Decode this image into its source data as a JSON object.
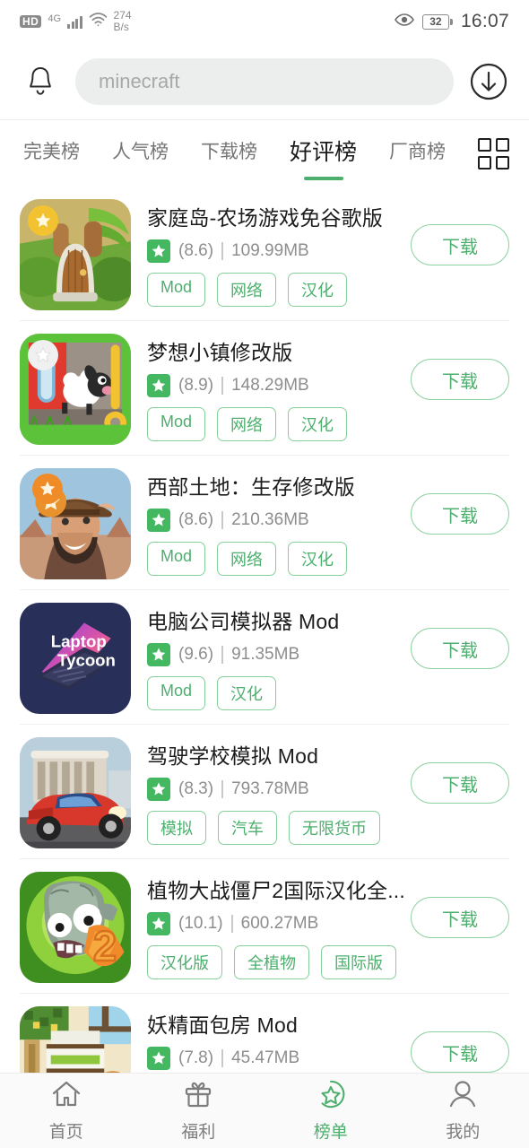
{
  "status_bar": {
    "hd_label": "HD",
    "network": "4G",
    "speed_value": "274",
    "speed_unit": "B/s",
    "eye_icon": "eye-icon",
    "battery_level": "32",
    "time": "16:07"
  },
  "header": {
    "bell_icon": "bell-icon",
    "download_icon": "download-circle-icon",
    "search_placeholder": "minecraft",
    "search_value": ""
  },
  "tabs": {
    "items": [
      {
        "label": "完美榜",
        "active": false
      },
      {
        "label": "人气榜",
        "active": false
      },
      {
        "label": "下载榜",
        "active": false
      },
      {
        "label": "好评榜",
        "active": true
      },
      {
        "label": "厂商榜",
        "active": false
      }
    ],
    "grid_icon": "grid-menu-icon"
  },
  "list": {
    "download_label": "下载",
    "items": [
      {
        "title": "家庭岛-农场游戏免谷歌版",
        "score": "(8.6)",
        "size": "109.99MB",
        "tags": [
          "Mod",
          "网络",
          "汉化"
        ],
        "icon": "family-island"
      },
      {
        "title": "梦想小镇修改版",
        "score": "(8.9)",
        "size": "148.29MB",
        "tags": [
          "Mod",
          "网络",
          "汉化"
        ],
        "icon": "township-sheep"
      },
      {
        "title": "西部土地：生存修改版",
        "score": "(8.6)",
        "size": "210.36MB",
        "tags": [
          "Mod",
          "网络",
          "汉化"
        ],
        "icon": "west-land-cowboy"
      },
      {
        "title": "电脑公司模拟器 Mod",
        "score": "(9.6)",
        "size": "91.35MB",
        "tags": [
          "Mod",
          "汉化"
        ],
        "icon": "laptop-tycoon",
        "icon_text_line1": "Laptop",
        "icon_text_line2": "Tycoon"
      },
      {
        "title": "驾驶学校模拟 Mod",
        "score": "(8.3)",
        "size": "793.78MB",
        "tags": [
          "模拟",
          "汽车",
          "无限货币"
        ],
        "icon": "driving-school-car"
      },
      {
        "title": "植物大战僵尸2国际汉化全...",
        "score": "(10.1)",
        "size": "600.27MB",
        "tags": [
          "汉化版",
          "全植物",
          "国际版"
        ],
        "icon": "pvz2-zombie"
      },
      {
        "title": "妖精面包房 Mod",
        "score": "(7.8)",
        "size": "45.47MB",
        "tags": [],
        "icon": "fairy-bakery"
      }
    ]
  },
  "bottom_nav": {
    "items": [
      {
        "label": "首页",
        "icon": "home-icon",
        "active": false
      },
      {
        "label": "福利",
        "icon": "gift-icon",
        "active": false
      },
      {
        "label": "榜单",
        "icon": "star-circle-icon",
        "active": true
      },
      {
        "label": "我的",
        "icon": "person-icon",
        "active": false
      }
    ]
  },
  "colors": {
    "accent_green": "#4caf6d",
    "tag_border": "#86d09b",
    "muted_text": "#8d8d8d"
  }
}
